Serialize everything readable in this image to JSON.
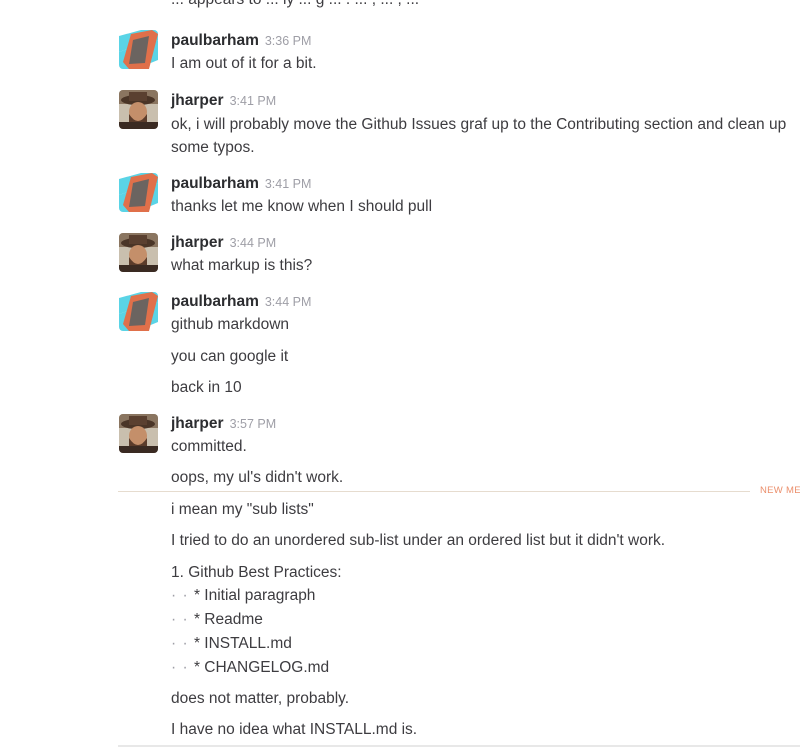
{
  "clipped_text": "... appears to ... ly ... g ... . ... , ... , ...",
  "messages": [
    {
      "user": "paulbarham",
      "time": "3:36 PM",
      "lines": [
        "I am out of it for a bit."
      ]
    },
    {
      "user": "jharper",
      "time": "3:41 PM",
      "lines": [
        "ok, i will probably move the Github Issues graf  up to the Contributing section and clean up some typos."
      ]
    },
    {
      "user": "paulbarham",
      "time": "3:41 PM",
      "lines": [
        "thanks let me know when I should pull"
      ]
    },
    {
      "user": "jharper",
      "time": "3:44 PM",
      "lines": [
        "what markup is this?"
      ]
    },
    {
      "user": "paulbarham",
      "time": "3:44 PM",
      "lines": [
        "github markdown",
        "you can google it",
        "back in 10"
      ]
    },
    {
      "user": "jharper",
      "time": "3:57 PM",
      "lines": [
        "committed.",
        "oops, my ul's didn't work."
      ]
    }
  ],
  "new_messages_label": "NEW MES",
  "after_divider": {
    "line1": "i mean my \"sub lists\"",
    "line2": "I tried to do an unordered sub-list under an ordered list but it didn't work.",
    "list_head": "1. Github Best Practices:",
    "list_dots": "· · ",
    "list_items": [
      "* Initial paragraph",
      "* Readme",
      "* INSTALL.md",
      "* CHANGELOG.md"
    ],
    "line3": "does not matter, probably.",
    "line4": "I have no idea what INSTALL.md is."
  },
  "colors": {
    "divider": "#e6dccf",
    "new_messages": "#eb8f6c",
    "avatar_cyan": "#5ad4e6",
    "avatar_orange": "#e0704a"
  }
}
